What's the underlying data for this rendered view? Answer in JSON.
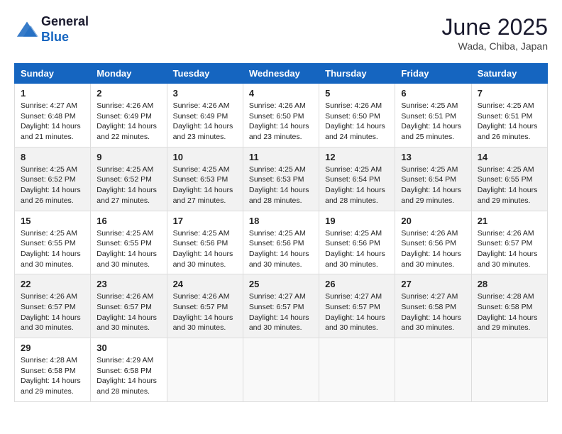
{
  "header": {
    "logo_line1": "General",
    "logo_line2": "Blue",
    "month_title": "June 2025",
    "location": "Wada, Chiba, Japan"
  },
  "weekdays": [
    "Sunday",
    "Monday",
    "Tuesday",
    "Wednesday",
    "Thursday",
    "Friday",
    "Saturday"
  ],
  "weeks": [
    [
      {
        "day": "1",
        "sunrise": "Sunrise: 4:27 AM",
        "sunset": "Sunset: 6:48 PM",
        "daylight": "Daylight: 14 hours and 21 minutes."
      },
      {
        "day": "2",
        "sunrise": "Sunrise: 4:26 AM",
        "sunset": "Sunset: 6:49 PM",
        "daylight": "Daylight: 14 hours and 22 minutes."
      },
      {
        "day": "3",
        "sunrise": "Sunrise: 4:26 AM",
        "sunset": "Sunset: 6:49 PM",
        "daylight": "Daylight: 14 hours and 23 minutes."
      },
      {
        "day": "4",
        "sunrise": "Sunrise: 4:26 AM",
        "sunset": "Sunset: 6:50 PM",
        "daylight": "Daylight: 14 hours and 23 minutes."
      },
      {
        "day": "5",
        "sunrise": "Sunrise: 4:26 AM",
        "sunset": "Sunset: 6:50 PM",
        "daylight": "Daylight: 14 hours and 24 minutes."
      },
      {
        "day": "6",
        "sunrise": "Sunrise: 4:25 AM",
        "sunset": "Sunset: 6:51 PM",
        "daylight": "Daylight: 14 hours and 25 minutes."
      },
      {
        "day": "7",
        "sunrise": "Sunrise: 4:25 AM",
        "sunset": "Sunset: 6:51 PM",
        "daylight": "Daylight: 14 hours and 26 minutes."
      }
    ],
    [
      {
        "day": "8",
        "sunrise": "Sunrise: 4:25 AM",
        "sunset": "Sunset: 6:52 PM",
        "daylight": "Daylight: 14 hours and 26 minutes."
      },
      {
        "day": "9",
        "sunrise": "Sunrise: 4:25 AM",
        "sunset": "Sunset: 6:52 PM",
        "daylight": "Daylight: 14 hours and 27 minutes."
      },
      {
        "day": "10",
        "sunrise": "Sunrise: 4:25 AM",
        "sunset": "Sunset: 6:53 PM",
        "daylight": "Daylight: 14 hours and 27 minutes."
      },
      {
        "day": "11",
        "sunrise": "Sunrise: 4:25 AM",
        "sunset": "Sunset: 6:53 PM",
        "daylight": "Daylight: 14 hours and 28 minutes."
      },
      {
        "day": "12",
        "sunrise": "Sunrise: 4:25 AM",
        "sunset": "Sunset: 6:54 PM",
        "daylight": "Daylight: 14 hours and 28 minutes."
      },
      {
        "day": "13",
        "sunrise": "Sunrise: 4:25 AM",
        "sunset": "Sunset: 6:54 PM",
        "daylight": "Daylight: 14 hours and 29 minutes."
      },
      {
        "day": "14",
        "sunrise": "Sunrise: 4:25 AM",
        "sunset": "Sunset: 6:55 PM",
        "daylight": "Daylight: 14 hours and 29 minutes."
      }
    ],
    [
      {
        "day": "15",
        "sunrise": "Sunrise: 4:25 AM",
        "sunset": "Sunset: 6:55 PM",
        "daylight": "Daylight: 14 hours and 30 minutes."
      },
      {
        "day": "16",
        "sunrise": "Sunrise: 4:25 AM",
        "sunset": "Sunset: 6:55 PM",
        "daylight": "Daylight: 14 hours and 30 minutes."
      },
      {
        "day": "17",
        "sunrise": "Sunrise: 4:25 AM",
        "sunset": "Sunset: 6:56 PM",
        "daylight": "Daylight: 14 hours and 30 minutes."
      },
      {
        "day": "18",
        "sunrise": "Sunrise: 4:25 AM",
        "sunset": "Sunset: 6:56 PM",
        "daylight": "Daylight: 14 hours and 30 minutes."
      },
      {
        "day": "19",
        "sunrise": "Sunrise: 4:25 AM",
        "sunset": "Sunset: 6:56 PM",
        "daylight": "Daylight: 14 hours and 30 minutes."
      },
      {
        "day": "20",
        "sunrise": "Sunrise: 4:26 AM",
        "sunset": "Sunset: 6:56 PM",
        "daylight": "Daylight: 14 hours and 30 minutes."
      },
      {
        "day": "21",
        "sunrise": "Sunrise: 4:26 AM",
        "sunset": "Sunset: 6:57 PM",
        "daylight": "Daylight: 14 hours and 30 minutes."
      }
    ],
    [
      {
        "day": "22",
        "sunrise": "Sunrise: 4:26 AM",
        "sunset": "Sunset: 6:57 PM",
        "daylight": "Daylight: 14 hours and 30 minutes."
      },
      {
        "day": "23",
        "sunrise": "Sunrise: 4:26 AM",
        "sunset": "Sunset: 6:57 PM",
        "daylight": "Daylight: 14 hours and 30 minutes."
      },
      {
        "day": "24",
        "sunrise": "Sunrise: 4:26 AM",
        "sunset": "Sunset: 6:57 PM",
        "daylight": "Daylight: 14 hours and 30 minutes."
      },
      {
        "day": "25",
        "sunrise": "Sunrise: 4:27 AM",
        "sunset": "Sunset: 6:57 PM",
        "daylight": "Daylight: 14 hours and 30 minutes."
      },
      {
        "day": "26",
        "sunrise": "Sunrise: 4:27 AM",
        "sunset": "Sunset: 6:57 PM",
        "daylight": "Daylight: 14 hours and 30 minutes."
      },
      {
        "day": "27",
        "sunrise": "Sunrise: 4:27 AM",
        "sunset": "Sunset: 6:58 PM",
        "daylight": "Daylight: 14 hours and 30 minutes."
      },
      {
        "day": "28",
        "sunrise": "Sunrise: 4:28 AM",
        "sunset": "Sunset: 6:58 PM",
        "daylight": "Daylight: 14 hours and 29 minutes."
      }
    ],
    [
      {
        "day": "29",
        "sunrise": "Sunrise: 4:28 AM",
        "sunset": "Sunset: 6:58 PM",
        "daylight": "Daylight: 14 hours and 29 minutes."
      },
      {
        "day": "30",
        "sunrise": "Sunrise: 4:29 AM",
        "sunset": "Sunset: 6:58 PM",
        "daylight": "Daylight: 14 hours and 28 minutes."
      },
      null,
      null,
      null,
      null,
      null
    ]
  ]
}
